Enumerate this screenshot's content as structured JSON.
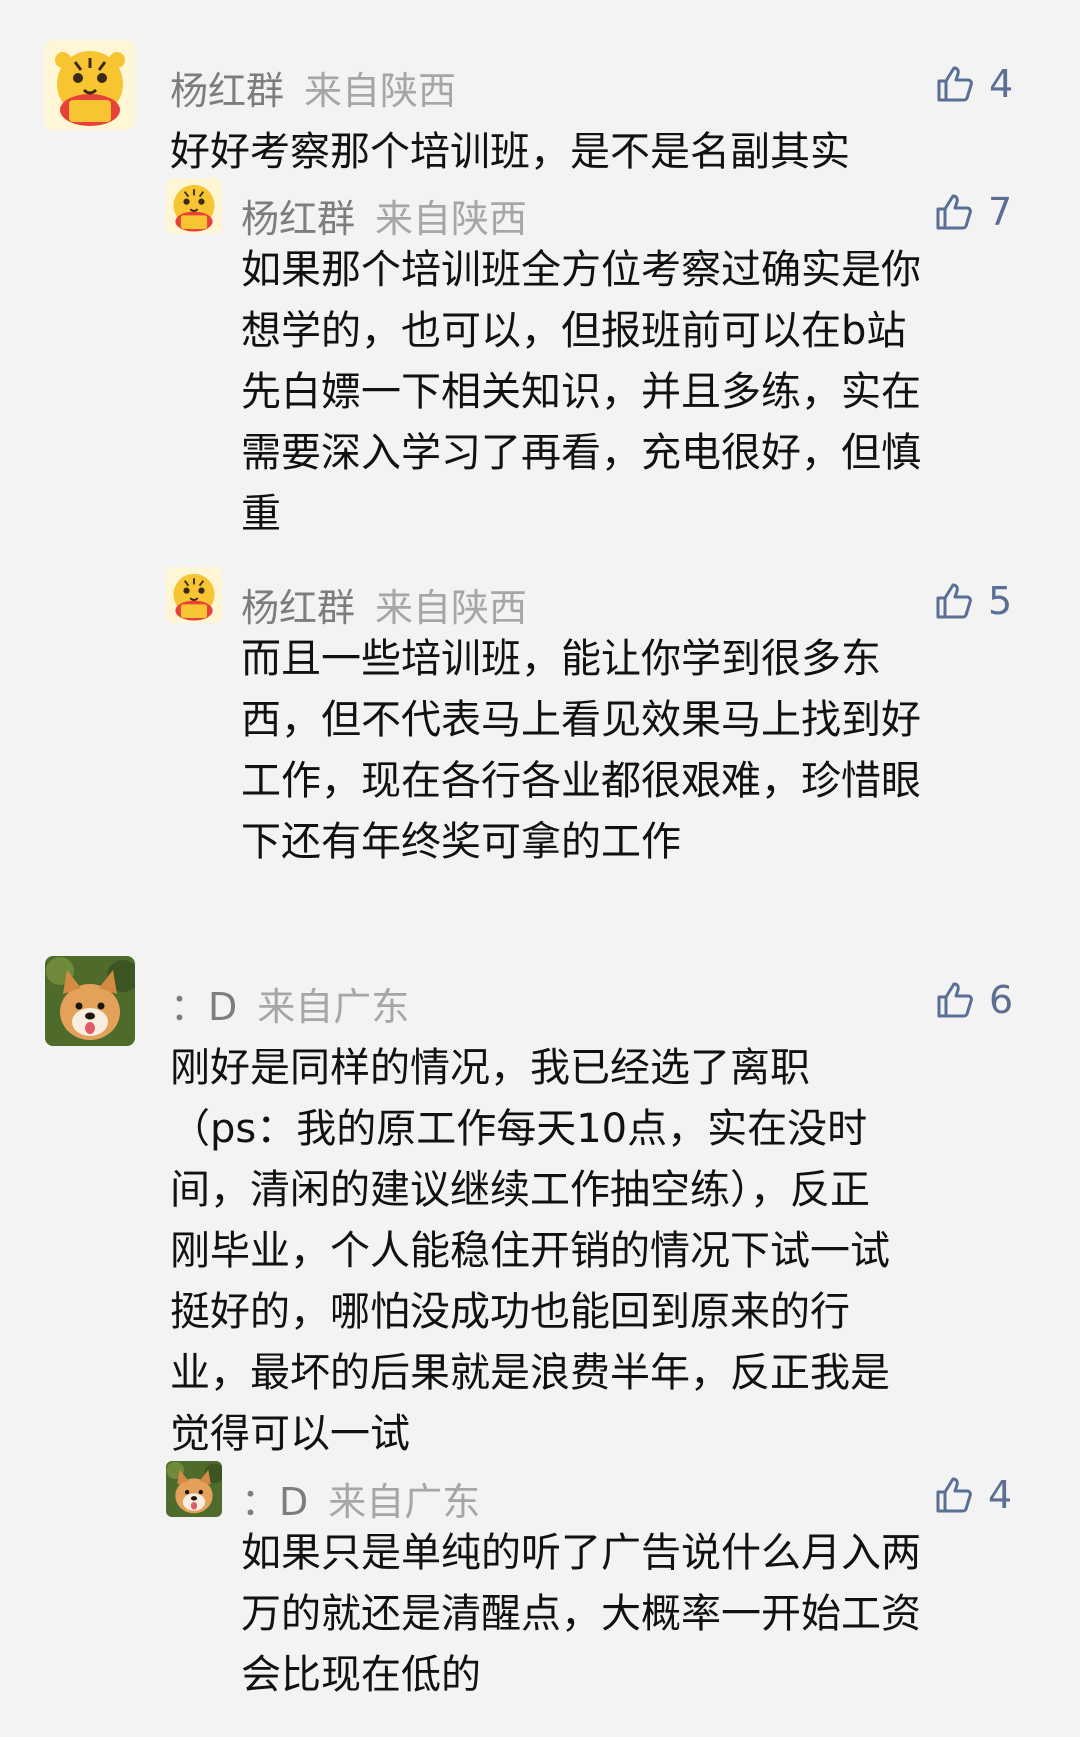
{
  "comments": [
    {
      "name": "杨红群",
      "region": "来自陕西",
      "likes": "4",
      "text": "好好考察那个培训班，是不是名副其实",
      "avatar": "tiger-avatar",
      "replies": [
        {
          "name": "杨红群",
          "region": "来自陕西",
          "likes": "7",
          "text": "如果那个培训班全方位考察过确实是你\n想学的，也可以，但报班前可以在b站\n先白嫖一下相关知识，并且多练，实在\n需要深入学习了再看，充电很好，但慎\n重",
          "avatar": "tiger-avatar"
        },
        {
          "name": "杨红群",
          "region": "来自陕西",
          "likes": "5",
          "text": "而且一些培训班，能让你学到很多东\n西，但不代表马上看见效果马上找到好\n工作，现在各行各业都很艰难，珍惜眼\n下还有年终奖可拿的工作",
          "avatar": "tiger-avatar"
        }
      ]
    },
    {
      "name": "：D",
      "region": "来自广东",
      "likes": "6",
      "text": "刚好是同样的情况，我已经选了离职\n（ps：我的原工作每天10点，实在没时\n间，清闲的建议继续工作抽空练），反正\n刚毕业，个人能稳住开销的情况下试一试\n挺好的，哪怕没成功也能回到原来的行\n业，最坏的后果就是浪费半年，反正我是\n觉得可以一试",
      "avatar": "dog-avatar",
      "replies": [
        {
          "name": "：D",
          "region": "来自广东",
          "likes": "4",
          "text": "如果只是单纯的听了广告说什么月入两\n万的就还是清醒点，大概率一开始工资\n会比现在低的",
          "avatar": "dog-avatar"
        }
      ]
    }
  ],
  "icons": {
    "like": "thumbs-up-icon"
  },
  "colors": {
    "background": "#f3f3f3",
    "like": "#5a6f96",
    "name": "#7d7d7d",
    "region": "#a6a6a6"
  }
}
